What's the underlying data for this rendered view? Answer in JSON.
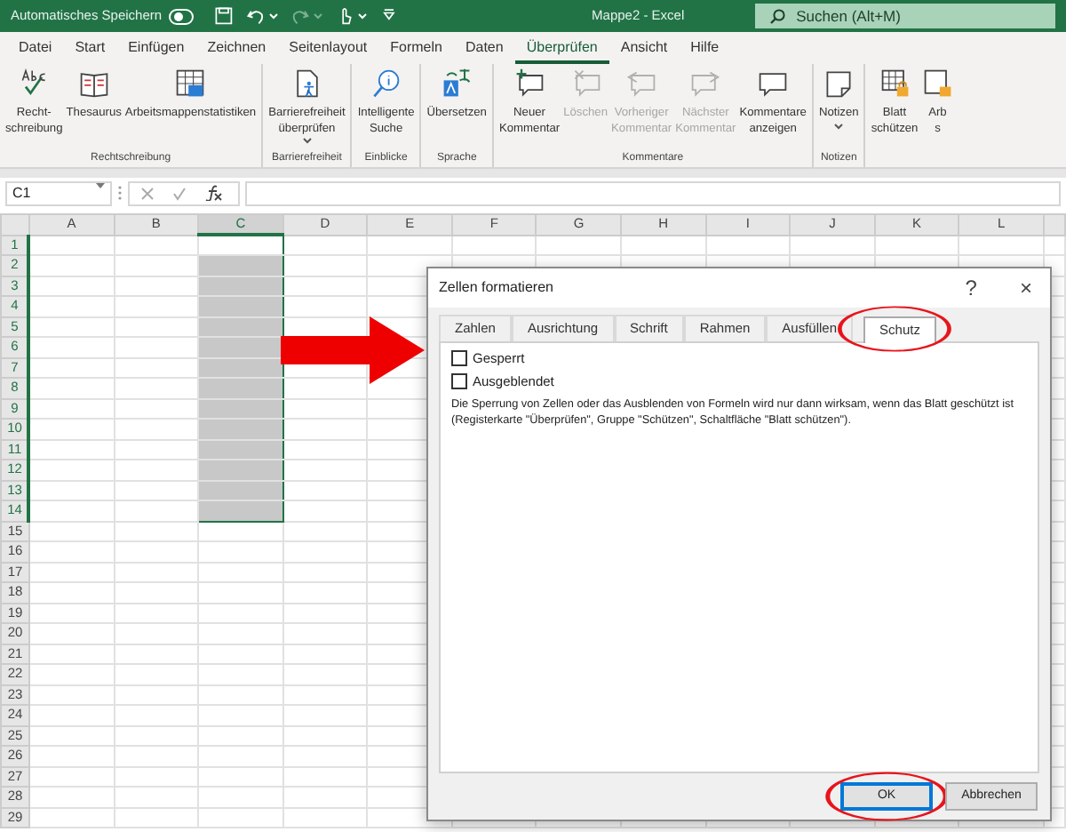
{
  "titlebar": {
    "autosave": {
      "label": "Automatisches Speichern",
      "on": false
    },
    "quick_access": [
      {
        "kind": "save",
        "disabled": false,
        "dropdown": false
      },
      {
        "kind": "undo",
        "disabled": false,
        "dropdown": true
      },
      {
        "kind": "redo",
        "disabled": true,
        "dropdown": true
      },
      {
        "kind": "touch",
        "disabled": false,
        "dropdown": true
      },
      {
        "kind": "customize",
        "disabled": false,
        "dropdown": false
      }
    ],
    "title": "Mappe2  -  Excel",
    "search": {
      "placeholder": "Suchen (Alt+M)"
    }
  },
  "menu_tabs": [
    {
      "label": "Datei",
      "selected": false
    },
    {
      "label": "Start",
      "selected": false
    },
    {
      "label": "Einfügen",
      "selected": false
    },
    {
      "label": "Zeichnen",
      "selected": false
    },
    {
      "label": "Seitenlayout",
      "selected": false
    },
    {
      "label": "Formeln",
      "selected": false
    },
    {
      "label": "Daten",
      "selected": false
    },
    {
      "label": "Überprüfen",
      "selected": true
    },
    {
      "label": "Ansicht",
      "selected": false
    },
    {
      "label": "Hilfe",
      "selected": false
    }
  ],
  "ribbon": [
    {
      "title": "Rechtschreibung",
      "buttons": [
        {
          "kind": "spelling",
          "label": [
            "Recht-",
            "schreibung"
          ],
          "disabled": false,
          "dropdown": false
        },
        {
          "kind": "book",
          "label": [
            "Thesaurus"
          ],
          "disabled": false,
          "dropdown": false
        },
        {
          "kind": "stats",
          "label": [
            "Arbeitsmappenstatistiken"
          ],
          "disabled": false,
          "dropdown": false
        }
      ]
    },
    {
      "title": "Barrierefreiheit",
      "buttons": [
        {
          "kind": "accessibility",
          "label": [
            "Barrierefreiheit",
            "überprüfen"
          ],
          "disabled": false,
          "dropdown": true
        }
      ]
    },
    {
      "title": "Einblicke",
      "buttons": [
        {
          "kind": "insight",
          "label": [
            "Intelligente",
            "Suche"
          ],
          "disabled": false,
          "dropdown": false
        }
      ]
    },
    {
      "title": "Sprache",
      "buttons": [
        {
          "kind": "translate",
          "label": [
            "Übersetzen"
          ],
          "disabled": false,
          "dropdown": false
        }
      ]
    },
    {
      "title": "Kommentare",
      "buttons": [
        {
          "kind": "comment_new",
          "label": [
            "Neuer",
            "Kommentar"
          ],
          "disabled": false,
          "dropdown": false
        },
        {
          "kind": "comment_delete",
          "label": [
            "Löschen"
          ],
          "disabled": true,
          "dropdown": false
        },
        {
          "kind": "comment_prev",
          "label": [
            "Vorheriger",
            "Kommentar"
          ],
          "disabled": true,
          "dropdown": false
        },
        {
          "kind": "comment_next",
          "label": [
            "Nächster",
            "Kommentar"
          ],
          "disabled": true,
          "dropdown": false
        },
        {
          "kind": "comment",
          "label": [
            "Kommentare",
            "anzeigen"
          ],
          "disabled": false,
          "dropdown": false
        }
      ]
    },
    {
      "title": "Notizen",
      "buttons": [
        {
          "kind": "note",
          "label": [
            "Notizen"
          ],
          "disabled": false,
          "dropdown": true
        }
      ]
    },
    {
      "buttons": [
        {
          "kind": "sheet_lock",
          "label": [
            "Blatt",
            "schützen"
          ],
          "disabled": false,
          "dropdown": false
        },
        {
          "kind": "book_lock",
          "label": [
            "Arb",
            "s"
          ],
          "disabled": false,
          "dropdown": false
        }
      ]
    }
  ],
  "formula_bar": {
    "name_box": "C1"
  },
  "sheet": {
    "columns": [
      {
        "label": "A",
        "selected": false
      },
      {
        "label": "B",
        "selected": false
      },
      {
        "label": "C",
        "selected": true
      },
      {
        "label": "D",
        "selected": false
      },
      {
        "label": "E",
        "selected": false
      },
      {
        "label": "F",
        "selected": false
      },
      {
        "label": "G",
        "selected": false
      },
      {
        "label": "H",
        "selected": false
      },
      {
        "label": "I",
        "selected": false
      },
      {
        "label": "J",
        "selected": false
      },
      {
        "label": "K",
        "selected": false
      },
      {
        "label": "L",
        "selected": false
      }
    ],
    "rows": [
      {
        "label": "1",
        "selected": true
      },
      {
        "label": "2",
        "selected": true
      },
      {
        "label": "3",
        "selected": true
      },
      {
        "label": "4",
        "selected": true
      },
      {
        "label": "5",
        "selected": true
      },
      {
        "label": "6",
        "selected": true
      },
      {
        "label": "7",
        "selected": true
      },
      {
        "label": "8",
        "selected": true
      },
      {
        "label": "9",
        "selected": true
      },
      {
        "label": "10",
        "selected": true
      },
      {
        "label": "11",
        "selected": true
      },
      {
        "label": "12",
        "selected": true
      },
      {
        "label": "13",
        "selected": true
      },
      {
        "label": "14",
        "selected": true
      },
      {
        "label": "15",
        "selected": false
      },
      {
        "label": "16",
        "selected": false
      },
      {
        "label": "17",
        "selected": false
      },
      {
        "label": "18",
        "selected": false
      },
      {
        "label": "19",
        "selected": false
      },
      {
        "label": "20",
        "selected": false
      },
      {
        "label": "21",
        "selected": false
      },
      {
        "label": "22",
        "selected": false
      },
      {
        "label": "23",
        "selected": false
      },
      {
        "label": "24",
        "selected": false
      },
      {
        "label": "25",
        "selected": false
      },
      {
        "label": "26",
        "selected": false
      },
      {
        "label": "27",
        "selected": false
      },
      {
        "label": "28",
        "selected": false
      },
      {
        "label": "29",
        "selected": false
      }
    ]
  },
  "dialog": {
    "title": "Zellen formatieren",
    "help": "?",
    "close": "×",
    "pointer_arrow": true,
    "tabs": [
      {
        "label": "Zahlen",
        "selected": false,
        "circled": false
      },
      {
        "label": "Ausrichtung",
        "selected": false,
        "circled": false
      },
      {
        "label": "Schrift",
        "selected": false,
        "circled": false
      },
      {
        "label": "Rahmen",
        "selected": false,
        "circled": false
      },
      {
        "label": "Ausfüllen",
        "selected": false,
        "circled": false
      },
      {
        "label": "Schutz",
        "selected": true,
        "circled": true
      }
    ],
    "checkboxes": [
      {
        "label": "Gesperrt",
        "checked": false
      },
      {
        "label": "Ausgeblendet",
        "checked": false
      }
    ],
    "note": "Die Sperrung von Zellen oder das Ausblenden von Formeln wird nur dann wirksam, wenn das Blatt geschützt ist (Registerkarte \"Überprüfen\", Gruppe \"Schützen\", Schaltfläche \"Blatt schützen\").",
    "buttons": [
      {
        "label": "OK",
        "default": true,
        "circled": true
      },
      {
        "label": "Abbrechen",
        "default": false,
        "circled": false
      }
    ]
  }
}
